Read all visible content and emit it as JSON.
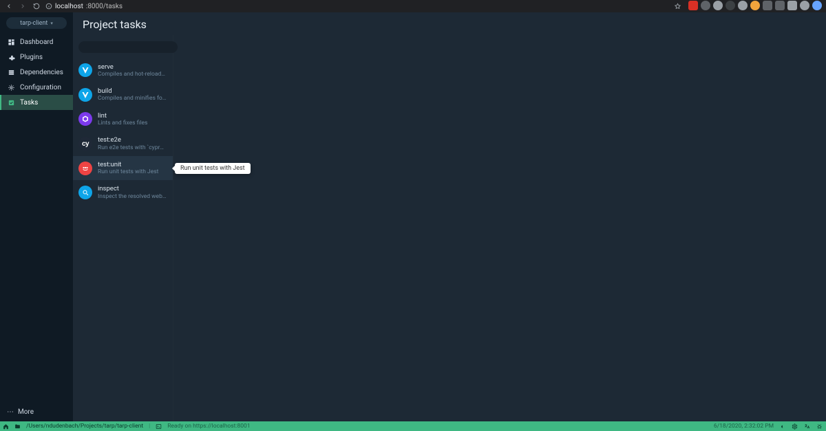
{
  "browser": {
    "url_host": "localhost",
    "url_pathport": ":8000/tasks",
    "extensions": [
      {
        "color": "#d93025",
        "shape": "sq"
      },
      {
        "color": "#5f6368",
        "shape": "round"
      },
      {
        "color": "#9aa0a6",
        "shape": "round"
      },
      {
        "color": "#3c4043",
        "shape": "round"
      },
      {
        "color": "#9aa0a6",
        "shape": "round"
      },
      {
        "color": "#f1a33c",
        "shape": "round"
      },
      {
        "color": "#5f6368",
        "shape": "sq"
      },
      {
        "color": "#5f6368",
        "shape": "sq"
      },
      {
        "color": "#9aa0a6",
        "shape": "sq"
      },
      {
        "color": "#9aa0a6",
        "shape": "round"
      },
      {
        "color": "#66a3ff",
        "shape": "round"
      }
    ]
  },
  "sidebar": {
    "project": "tarp-client",
    "items": [
      {
        "label": "Dashboard",
        "icon": "dashboard"
      },
      {
        "label": "Plugins",
        "icon": "plugin"
      },
      {
        "label": "Dependencies",
        "icon": "deps"
      },
      {
        "label": "Configuration",
        "icon": "config"
      },
      {
        "label": "Tasks",
        "icon": "tasks",
        "active": true
      }
    ],
    "more_label": "More"
  },
  "page": {
    "title": "Project tasks"
  },
  "search": {
    "placeholder": ""
  },
  "tasks": [
    {
      "title": "serve",
      "desc": "Compiles and hot-reloads f…",
      "icon": {
        "bg": "#0ea5e9",
        "type": "vue"
      }
    },
    {
      "title": "build",
      "desc": "Compiles and minifies for …",
      "icon": {
        "bg": "#0ea5e9",
        "type": "vue"
      }
    },
    {
      "title": "lint",
      "desc": "Lints and fixes files",
      "icon": {
        "bg": "#7c3aed",
        "type": "eslint"
      }
    },
    {
      "title": "test:e2e",
      "desc": "Run e2e tests with `cypress…",
      "icon": {
        "bg": "#1f2937",
        "type": "cy"
      }
    },
    {
      "title": "test:unit",
      "desc": "Run unit tests with Jest",
      "icon": {
        "bg": "#ef4444",
        "type": "jest"
      },
      "selected": true,
      "tooltip": "Run unit tests with Jest"
    },
    {
      "title": "inspect",
      "desc": "Inspect the resolved webp…",
      "icon": {
        "bg": "#0ea5e9",
        "type": "inspect"
      }
    }
  ],
  "statusbar": {
    "path": "/Users/ndudenbach/Projects/tarp/tarp-client",
    "ready_label": "Ready on https://localhost:8001",
    "right_text": "6/18/2020, 2:32:02 PM"
  }
}
